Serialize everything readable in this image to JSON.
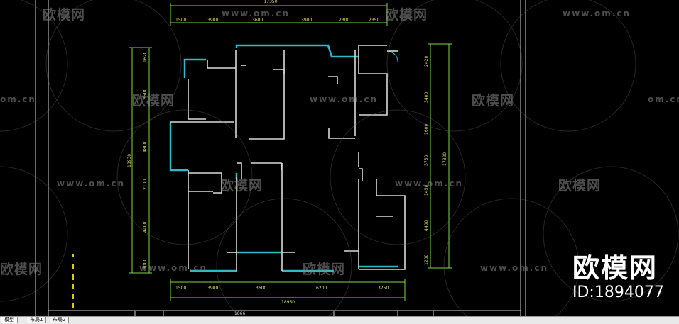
{
  "drawing": {
    "top_total": "17350",
    "top_dims": [
      "1500",
      "3900",
      "3600",
      "3900",
      "2300",
      "2350"
    ],
    "bottom_dims": [
      "1500",
      "3900",
      "3600",
      "6200",
      "3750"
    ],
    "bottom_total": "18950",
    "left_dims": [
      "1620",
      "3500",
      "4800",
      "2100",
      "4400",
      "3000"
    ],
    "left_total": "18930",
    "right_dims": [
      "2420",
      "3400",
      "1600",
      "3750",
      "1450",
      "4400",
      "1200"
    ],
    "right_total": "17820",
    "title_block_text": "1866"
  },
  "watermarks": {
    "brand": "欧模网",
    "url": "www.om.cn",
    "url_short": "om.cn"
  },
  "badge": {
    "brand": "欧模网",
    "id": "ID:1894077"
  },
  "tabs": {
    "model": "模型",
    "layout1": "布局1",
    "layout2": "布局2"
  },
  "colors": {
    "background": "#000000",
    "wall": "#d9d9d9",
    "accent_wall": "#2fb8c8",
    "dimension": "#7fd64a",
    "dimension_text": "#cfe25a"
  }
}
